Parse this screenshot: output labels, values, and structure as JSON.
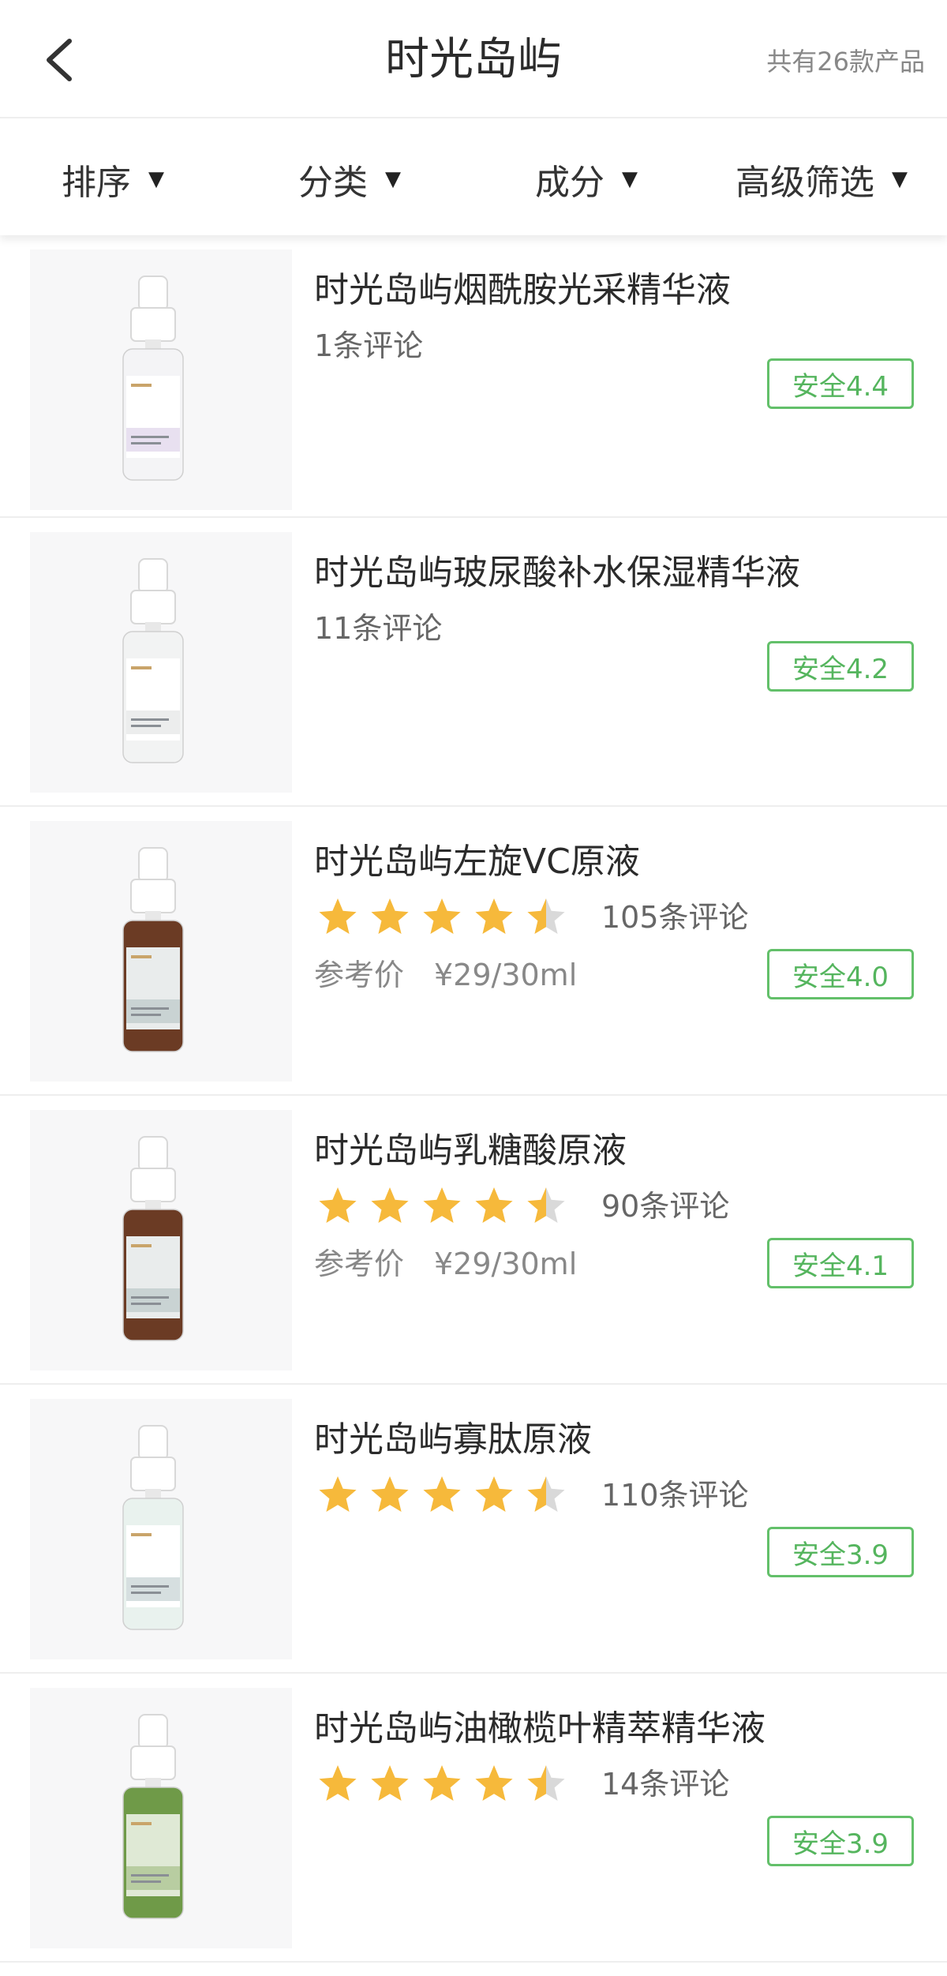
{
  "header": {
    "title": "时光岛屿",
    "count_text": "共有26款产品"
  },
  "filters": [
    {
      "label": "排序"
    },
    {
      "label": "分类"
    },
    {
      "label": "成分"
    },
    {
      "label": "高级筛选"
    }
  ],
  "colors": {
    "accent_green": "#55b55e",
    "star": "#f6b93b",
    "star_empty": "#d9d9d9"
  },
  "products": [
    {
      "name": "时光岛屿烟酰胺光采精华液",
      "reviews": "1条评论",
      "rating": null,
      "price_label": "",
      "price": "",
      "safety": "安全4.4",
      "bottle": "clear-pastel"
    },
    {
      "name": "时光岛屿玻尿酸补水保湿精华液",
      "reviews": "11条评论",
      "rating": null,
      "price_label": "",
      "price": "",
      "safety": "安全4.2",
      "bottle": "clear"
    },
    {
      "name": "时光岛屿左旋VC原液",
      "reviews": "105条评论",
      "rating": 4.5,
      "price_label": "参考价",
      "price": "¥29/30ml",
      "safety": "安全4.0",
      "bottle": "amber"
    },
    {
      "name": "时光岛屿乳糖酸原液",
      "reviews": "90条评论",
      "rating": 4.5,
      "price_label": "参考价",
      "price": "¥29/30ml",
      "safety": "安全4.1",
      "bottle": "amber"
    },
    {
      "name": "时光岛屿寡肽原液",
      "reviews": "110条评论",
      "rating": 4.5,
      "price_label": "",
      "price": "",
      "safety": "安全3.9",
      "bottle": "clear-mint"
    },
    {
      "name": "时光岛屿油橄榄叶精萃精华液",
      "reviews": "14条评论",
      "rating": 4.5,
      "price_label": "",
      "price": "",
      "safety": "安全3.9",
      "bottle": "green"
    }
  ]
}
